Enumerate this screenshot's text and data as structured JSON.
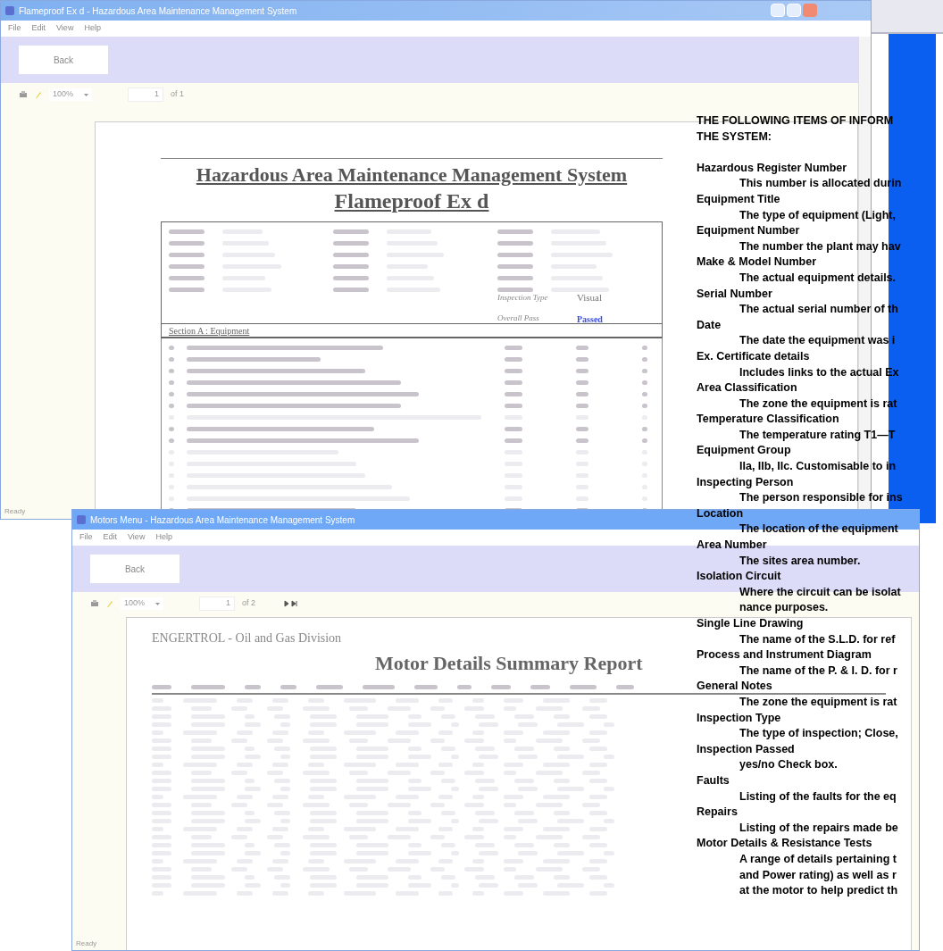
{
  "windows": [
    {
      "title": "Flameproof Ex d - Hazardous Area Maintenance Management System",
      "menu": [
        "File",
        "Edit",
        "View",
        "Help"
      ],
      "back_button": "Back",
      "toolbar": {
        "zoom": "100%",
        "page": "1",
        "page_count": "of 1"
      },
      "report": {
        "kind": "inspection",
        "title": "Hazardous Area Maintenance Management System",
        "subtitle": "Flameproof Ex d",
        "inspection_type_label": "Inspection Type",
        "inspection_type": "Visual",
        "overall_pass_label": "Overall Pass",
        "overall_pass": "Passed",
        "section": "Section A : Equipment"
      },
      "status": "Ready"
    },
    {
      "title": "Motors Menu - Hazardous Area Maintenance Management System",
      "menu": [
        "File",
        "Edit",
        "View",
        "Help"
      ],
      "back_button": "Back",
      "toolbar": {
        "zoom": "100%",
        "page": "1",
        "page_count": "of 2"
      },
      "report": {
        "kind": "summary",
        "company": "ENGERTROL - Oil and Gas Division",
        "title": "Motor Details Summary Report"
      },
      "status": "Ready"
    }
  ],
  "info_panel": {
    "heading_lines": [
      "THE FOLLOWING ITEMS OF INFORM",
      "THE SYSTEM:"
    ],
    "items": [
      {
        "title": "Hazardous Register Number",
        "description": [
          "This number is allocated durin"
        ]
      },
      {
        "title": "Equipment Title",
        "description": [
          "The type of equipment (Light,"
        ]
      },
      {
        "title": "Equipment Number",
        "description": [
          "The number the plant may hav"
        ]
      },
      {
        "title": "Make & Model Number",
        "description": [
          "The actual equipment details."
        ]
      },
      {
        "title": "Serial Number",
        "description": [
          "The actual serial number of th"
        ]
      },
      {
        "title": "Date",
        "description": [
          "The date the equipment was i"
        ]
      },
      {
        "title": "Ex. Certificate details",
        "description": [
          "Includes links to the actual Ex"
        ]
      },
      {
        "title": "Area Classification",
        "description": [
          "The zone the equipment is rat"
        ]
      },
      {
        "title": "Temperature Classification",
        "description": [
          "The temperature rating T1—T"
        ]
      },
      {
        "title": "Equipment Group",
        "description": [
          "IIa, IIb, IIc. Customisable to in"
        ]
      },
      {
        "title": "Inspecting Person",
        "description": [
          "The person responsible for ins"
        ]
      },
      {
        "title": "Location",
        "description": [
          "The location of the equipment"
        ]
      },
      {
        "title": "Area Number",
        "description": [
          "The sites area number."
        ]
      },
      {
        "title": "Isolation Circuit",
        "description": [
          "Where the circuit can be isolat",
          "nance purposes."
        ]
      },
      {
        "title": "Single Line Drawing",
        "description": [
          "The name of the S.L.D. for ref"
        ]
      },
      {
        "title": "Process and Instrument Diagram",
        "description": [
          "The name of the P. & I. D. for r"
        ]
      },
      {
        "title": "General Notes",
        "description": [
          "The zone the equipment is rat"
        ]
      },
      {
        "title": "Inspection Type",
        "description": [
          "The type of inspection; Close,"
        ]
      },
      {
        "title": "Inspection Passed",
        "description": [
          "yes/no Check box."
        ]
      },
      {
        "title": "Faults",
        "description": [
          "Listing of the faults for the eq"
        ]
      },
      {
        "title": "Repairs",
        "description": [
          "Listing of the repairs made be"
        ]
      },
      {
        "title": "Motor Details & Resistance Tests",
        "description": [
          "A range of details pertaining t",
          "and Power rating) as well as r",
          "at the motor to help predict th"
        ]
      }
    ]
  }
}
